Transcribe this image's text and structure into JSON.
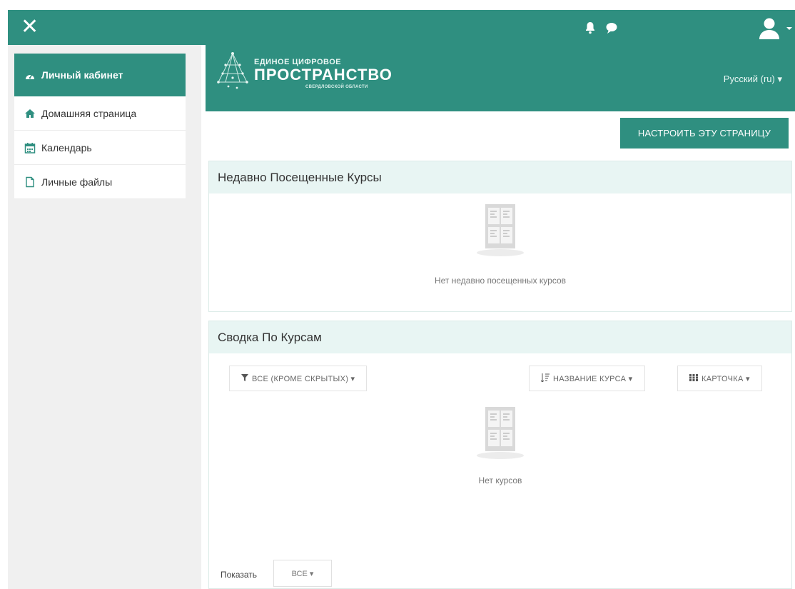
{
  "topbar": {
    "close_icon": "close-icon",
    "notification_icon": "bell-icon",
    "messages_icon": "chat-icon",
    "user_icon": "user-icon"
  },
  "sidebar": {
    "items": [
      {
        "label": "Личный кабинет",
        "icon": "dashboard-icon"
      },
      {
        "label": "Домашняя страница",
        "icon": "home-icon"
      },
      {
        "label": "Календарь",
        "icon": "calendar-icon"
      },
      {
        "label": "Личные файлы",
        "icon": "file-icon"
      }
    ]
  },
  "banner": {
    "logo_line1": "ЕДИНОЕ ЦИФРОВОЕ",
    "logo_line2": "ПРОСТРАНСТВО",
    "logo_line3": "СВЕРДЛОВСКОЙ ОБЛАСТИ",
    "language": "Русский (ru) ▾"
  },
  "main": {
    "customize_button": "НАСТРОИТЬ ЭТУ СТРАНИЦУ",
    "recent": {
      "title": "Недавно Посещенные Курсы",
      "empty": "Нет недавно посещенных курсов"
    },
    "overview": {
      "title": "Сводка По Курсам",
      "filter_all": "ВСЕ (КРОМЕ СКРЫТЫХ) ▾",
      "sort": "НАЗВАНИЕ КУРСА ▾",
      "view": "КАРТОЧКА ▾",
      "empty": "Нет курсов",
      "show_label": "Показать",
      "show_value": "ВСЕ ▾"
    }
  },
  "colors": {
    "primary": "#2f8f80",
    "header_bg": "#e8f5f3"
  }
}
